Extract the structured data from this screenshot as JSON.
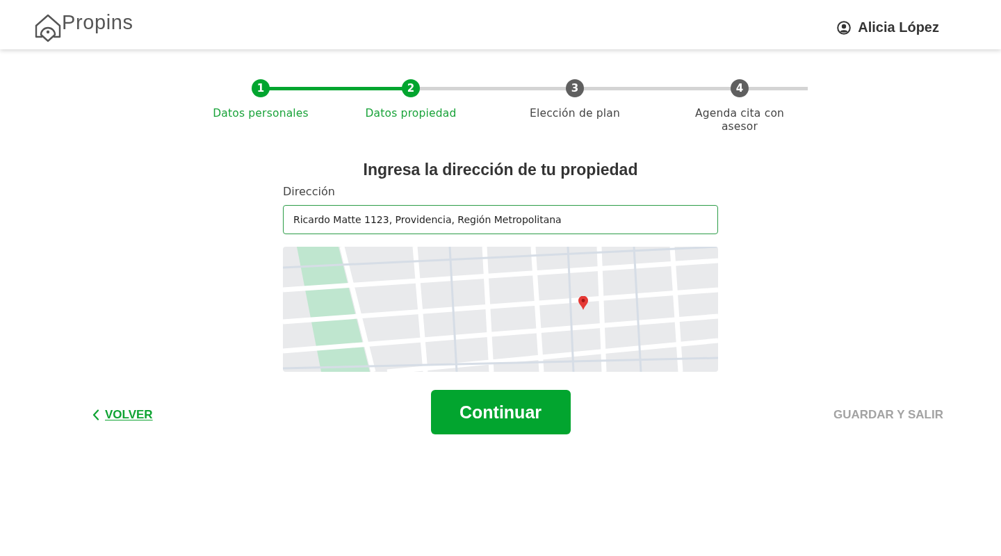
{
  "header": {
    "logo_text": "Propins",
    "user_name": "Alicia López"
  },
  "stepper": {
    "steps": [
      {
        "number": "1",
        "label": "Datos personales",
        "active": true
      },
      {
        "number": "2",
        "label": "Datos propiedad",
        "active": true
      },
      {
        "number": "3",
        "label": "Elección de plan",
        "active": false
      },
      {
        "number": "4",
        "label": "Agenda cita con asesor",
        "active": false
      }
    ]
  },
  "form": {
    "title": "Ingresa la dirección de tu propiedad",
    "address_field": {
      "label": "Dirección",
      "value": "Ricardo Matte 1123, Providencia, Región Metropolitana"
    }
  },
  "actions": {
    "back": "VOLVER",
    "continue": "Continuar",
    "save_exit": {
      "label": "GUARDAR Y SALIR",
      "disabled": true
    }
  }
}
